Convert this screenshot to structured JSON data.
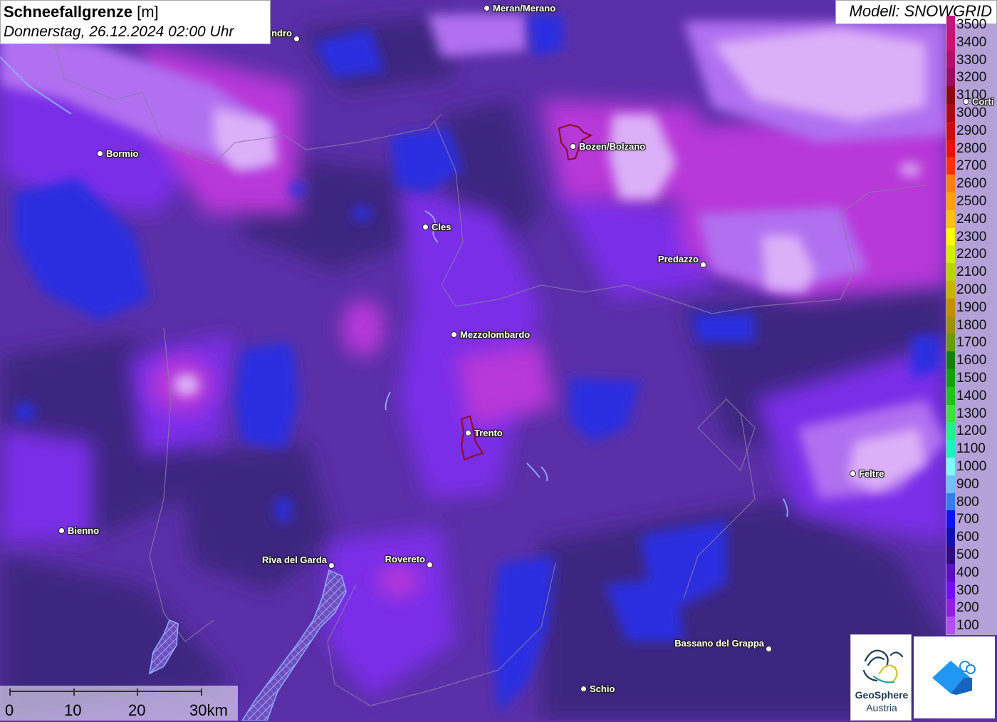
{
  "title": {
    "main": "Schneefallgrenze",
    "unit": "[m]",
    "datetime": "Donnerstag, 26.12.2024 02:00 Uhr"
  },
  "model_label": "Modell: SNOWGRID",
  "legend": [
    {
      "label": "3500",
      "color": "#c0187a"
    },
    {
      "label": "3400",
      "color": "#c8146e"
    },
    {
      "label": "3300",
      "color": "#b0106a"
    },
    {
      "label": "3200",
      "color": "#9a0e5e"
    },
    {
      "label": "3100",
      "color": "#8a0a14"
    },
    {
      "label": "3000",
      "color": "#a80c12"
    },
    {
      "label": "2900",
      "color": "#c80e10"
    },
    {
      "label": "2800",
      "color": "#e81010"
    },
    {
      "label": "2700",
      "color": "#ff3010"
    },
    {
      "label": "2600",
      "color": "#ff8010"
    },
    {
      "label": "2500",
      "color": "#ffa010"
    },
    {
      "label": "2400",
      "color": "#ffc010"
    },
    {
      "label": "2300",
      "color": "#ffff00"
    },
    {
      "label": "2200",
      "color": "#d0f000"
    },
    {
      "label": "2100",
      "color": "#b8d400"
    },
    {
      "label": "2000",
      "color": "#c8b400"
    },
    {
      "label": "1900",
      "color": "#c09000"
    },
    {
      "label": "1800",
      "color": "#a09010"
    },
    {
      "label": "1700",
      "color": "#6a9a10"
    },
    {
      "label": "1600",
      "color": "#108010"
    },
    {
      "label": "1500",
      "color": "#10a010"
    },
    {
      "label": "1400",
      "color": "#20c020"
    },
    {
      "label": "1300",
      "color": "#40e040"
    },
    {
      "label": "1200",
      "color": "#20f090"
    },
    {
      "label": "1100",
      "color": "#20f0c0"
    },
    {
      "label": "1000",
      "color": "#80f8ff"
    },
    {
      "label": "900",
      "color": "#70c0ff"
    },
    {
      "label": "800",
      "color": "#3080f0"
    },
    {
      "label": "700",
      "color": "#1010f0"
    },
    {
      "label": "600",
      "color": "#1010b0"
    },
    {
      "label": "500",
      "color": "#300a80"
    },
    {
      "label": "400",
      "color": "#5a10c0"
    },
    {
      "label": "300",
      "color": "#7010f0"
    },
    {
      "label": "200",
      "color": "#9020e0"
    },
    {
      "label": "100",
      "color": "#b050f0"
    }
  ],
  "cities": [
    {
      "name": "Meran/Merano",
      "label_side": "right"
    },
    {
      "name": "ndro",
      "label_side": "left"
    },
    {
      "name": "Bormio",
      "label_side": "right"
    },
    {
      "name": "Bozen/Bolzano",
      "label_side": "right"
    },
    {
      "name": "Corti",
      "label_side": "right"
    },
    {
      "name": "Cles",
      "label_side": "right"
    },
    {
      "name": "Predazzo",
      "label_side": "left"
    },
    {
      "name": "Mezzolombardo",
      "label_side": "right"
    },
    {
      "name": "Trento",
      "label_side": "right"
    },
    {
      "name": "Feltre",
      "label_side": "right"
    },
    {
      "name": "Bienno",
      "label_side": "right"
    },
    {
      "name": "Riva del Garda",
      "label_side": "left"
    },
    {
      "name": "Rovereto",
      "label_side": "left"
    },
    {
      "name": "Bassano del Grappa",
      "label_side": "left"
    },
    {
      "name": "Schio",
      "label_side": "right"
    }
  ],
  "scale": {
    "labels": [
      "0",
      "10",
      "20",
      "30km"
    ]
  },
  "logos": {
    "geosphere_line1": "GeoSphere",
    "geosphere_line2": "Austria"
  },
  "colors": {
    "base": "#5a2fa8",
    "dark_violet": "#3e2680",
    "violet": "#7a2ee8",
    "light_violet": "#b070f0",
    "pale": "#d8a0f8",
    "magenta": "#b838d8",
    "blue": "#2a2ee0"
  }
}
